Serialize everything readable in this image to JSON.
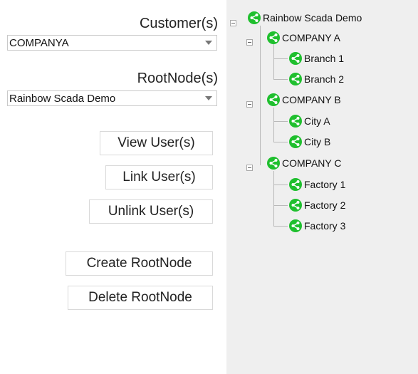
{
  "form": {
    "customers_label": "Customer(s)",
    "customers_value": "COMPANYA",
    "rootnode_label": "RootNode(s)",
    "rootnode_value": "Rainbow Scada Demo",
    "buttons": {
      "view_users": "View User(s)",
      "link_users": "Link User(s)",
      "unlink_users": "Unlink User(s)",
      "create_rootnode": "Create RootNode",
      "delete_rootnode": "Delete RootNode"
    }
  },
  "tree": {
    "root": "Rainbow Scada Demo",
    "companies": [
      {
        "name": "COMPANY A",
        "children": [
          "Branch 1",
          "Branch 2"
        ]
      },
      {
        "name": "COMPANY B",
        "children": [
          "City A",
          "City B"
        ]
      },
      {
        "name": "COMPANY C",
        "children": [
          "Factory 1",
          "Factory 2",
          "Factory 3"
        ]
      }
    ]
  },
  "icons": {
    "node": "share-icon"
  },
  "colors": {
    "icon_green": "#1fbf2e",
    "panel_bg": "#efefef"
  }
}
